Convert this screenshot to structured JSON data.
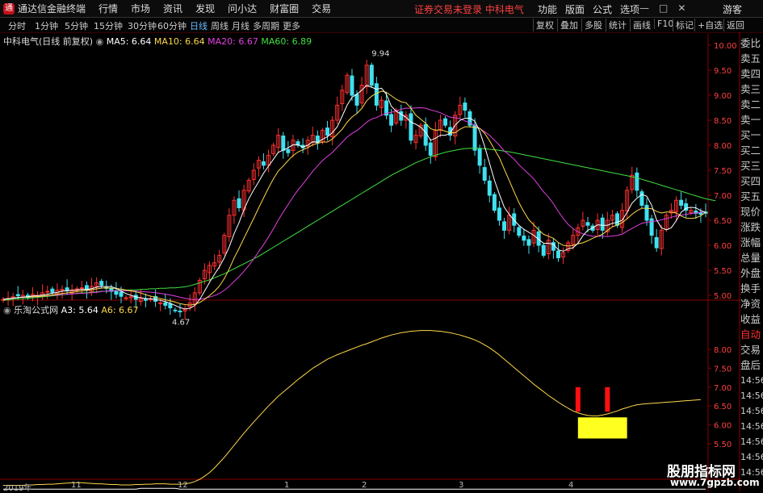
{
  "menu": {
    "app_title": "通达信金融终端",
    "items": [
      "行情",
      "市场",
      "资讯",
      "发现",
      "问小达",
      "财富圈",
      "交易"
    ],
    "alert": "证券交易未登录  中科电气",
    "right_items": [
      "功能",
      "版面",
      "公式",
      "选项"
    ],
    "window_controls": [
      "—",
      "□",
      "✕"
    ],
    "guest": "游客"
  },
  "toolbar": {
    "periods": [
      "分时",
      "1分钟",
      "5分钟",
      "15分钟",
      "30分钟",
      "60分钟",
      "日线",
      "周线",
      "月线",
      "多周期",
      "更多"
    ],
    "active_index": 6,
    "right_buttons": [
      "复权",
      "叠加",
      "多股",
      "统计",
      "画线",
      "F10",
      "标记",
      "+自选",
      "返回"
    ]
  },
  "main_legend": {
    "stock_name": "中科电气(日线 前复权)",
    "ma": [
      {
        "label": "MA5: 6.64",
        "color": "#ffffff"
      },
      {
        "label": "MA10: 6.64",
        "color": "#ffd84a"
      },
      {
        "label": "MA20: 6.67",
        "color": "#e040e0"
      },
      {
        "label": "MA60: 6.89",
        "color": "#40e040"
      }
    ]
  },
  "indicator_legend": {
    "name": "乐淘公式网",
    "lines": [
      {
        "label": "A3: 5.64",
        "color": "#ffffff"
      },
      {
        "label": "A6: 6.67",
        "color": "#ffd84a"
      }
    ]
  },
  "price_axis": [
    "10.00",
    "9.50",
    "9.00",
    "8.50",
    "8.00",
    "7.50",
    "7.00",
    "6.50",
    "6.00",
    "5.50",
    "5.00"
  ],
  "ind_axis": [
    "8.00",
    "7.50",
    "7.00",
    "6.50",
    "6.00",
    "5.50"
  ],
  "annotations": {
    "high": "9.94",
    "low": "4.67"
  },
  "right_panel": {
    "labels": [
      "委比",
      "卖五",
      "卖四",
      "卖三",
      "卖二",
      "卖一",
      "买一",
      "买二",
      "买三",
      "买四",
      "买五",
      "现价",
      "涨跌",
      "涨幅",
      "总量",
      "外盘",
      "换手",
      "净资",
      "收益"
    ],
    "auto": "自动",
    "extra": [
      "交易",
      "盘后"
    ],
    "times": [
      "14:56",
      "14:56",
      "14:56",
      "14:56",
      "14:56",
      "14:56",
      "14:56",
      "14:56",
      "14:56",
      "14:56"
    ]
  },
  "date_axis": [
    "2019年",
    "11",
    "12",
    "1",
    "2",
    "3",
    "4"
  ],
  "watermark": {
    "line1": "股朋指标网",
    "line2": "www.7gpzb.com"
  },
  "colors": {
    "up": "#ff3030",
    "down": "#40e0f0",
    "ma5": "#ffffff",
    "ma10": "#ffd84a",
    "ma20": "#e040e0",
    "ma60": "#40e040",
    "box": "#ffff20"
  },
  "chart_data": {
    "type": "candlestick",
    "close": [
      4.92,
      4.94,
      4.97,
      4.99,
      5.0,
      4.96,
      5.02,
      5.0,
      5.05,
      5.08,
      5.06,
      5.1,
      5.12,
      5.09,
      5.11,
      5.13,
      5.15,
      5.1,
      5.18,
      5.25,
      5.2,
      5.15,
      5.08,
      5.02,
      4.98,
      4.95,
      4.97,
      4.92,
      4.94,
      4.9,
      4.93,
      4.88,
      4.85,
      4.8,
      4.75,
      4.7,
      4.67,
      4.72,
      4.85,
      5.05,
      5.3,
      5.5,
      5.6,
      5.65,
      5.8,
      6.2,
      6.6,
      6.9,
      6.75,
      7.1,
      7.3,
      7.5,
      7.7,
      7.6,
      7.8,
      8.0,
      8.2,
      7.9,
      7.85,
      8.1,
      8.0,
      7.95,
      8.1,
      8.2,
      8.05,
      8.3,
      8.2,
      8.5,
      8.8,
      9.1,
      9.4,
      9.0,
      8.8,
      9.2,
      9.6,
      9.2,
      8.8,
      8.9,
      8.6,
      8.4,
      8.7,
      8.5,
      8.6,
      8.1,
      8.2,
      8.4,
      8.0,
      7.8,
      8.3,
      8.5,
      8.4,
      8.2,
      8.6,
      8.8,
      8.7,
      8.4,
      7.9,
      7.6,
      7.3,
      7.0,
      6.7,
      6.5,
      6.3,
      6.6,
      6.4,
      6.2,
      6.1,
      6.0,
      6.3,
      6.0,
      5.8,
      6.1,
      5.9,
      5.75,
      5.85,
      6.05,
      6.2,
      6.35,
      6.5,
      6.4,
      6.3,
      6.5,
      6.3,
      6.5,
      6.6,
      6.4,
      6.7,
      7.1,
      7.4,
      7.1,
      6.8,
      6.5,
      6.2,
      5.95,
      6.3,
      6.6,
      6.7,
      6.9,
      6.8,
      6.7,
      6.7,
      6.64,
      6.62,
      6.64
    ],
    "ma60": [
      4.9,
      4.91,
      4.92,
      4.93,
      4.93,
      4.94,
      4.95,
      4.96,
      4.97,
      4.98,
      4.99,
      5.0,
      5.01,
      5.02,
      5.03,
      5.04,
      5.05,
      5.05,
      5.06,
      5.07,
      5.08,
      5.08,
      5.09,
      5.09,
      5.1,
      5.1,
      5.11,
      5.11,
      5.12,
      5.12,
      5.13,
      5.13,
      5.14,
      5.14,
      5.15,
      5.15,
      5.16,
      5.17,
      5.19,
      5.22,
      5.25,
      5.28,
      5.31,
      5.35,
      5.39,
      5.43,
      5.48,
      5.53,
      5.58,
      5.63,
      5.68,
      5.73,
      5.78,
      5.84,
      5.9,
      5.96,
      6.02,
      6.08,
      6.14,
      6.2,
      6.26,
      6.32,
      6.38,
      6.44,
      6.5,
      6.56,
      6.62,
      6.68,
      6.74,
      6.8,
      6.86,
      6.92,
      6.98,
      7.04,
      7.1,
      7.16,
      7.22,
      7.28,
      7.34,
      7.4,
      7.45,
      7.5,
      7.55,
      7.6,
      7.65,
      7.69,
      7.73,
      7.77,
      7.8,
      7.83,
      7.86,
      7.88,
      7.9,
      7.92,
      7.93,
      7.94,
      7.94,
      7.94,
      7.93,
      7.92,
      7.91,
      7.9,
      7.88,
      7.87,
      7.85,
      7.83,
      7.81,
      7.79,
      7.77,
      7.75,
      7.73,
      7.71,
      7.69,
      7.67,
      7.65,
      7.63,
      7.61,
      7.59,
      7.57,
      7.55,
      7.53,
      7.51,
      7.49,
      7.47,
      7.45,
      7.43,
      7.41,
      7.39,
      7.37,
      7.35,
      7.32,
      7.29,
      7.26,
      7.23,
      7.2,
      7.17,
      7.14,
      7.11,
      7.08,
      7.05,
      7.02,
      6.99,
      6.96,
      6.93,
      6.91,
      6.89
    ],
    "a6": [
      4.4,
      4.4,
      4.4,
      4.4,
      4.4,
      4.41,
      4.41,
      4.42,
      4.42,
      4.43,
      4.43,
      4.44,
      4.45,
      4.46,
      4.47,
      4.47,
      4.47,
      4.46,
      4.45,
      4.44,
      4.44,
      4.43,
      4.42,
      4.42,
      4.41,
      4.41,
      4.41,
      4.42,
      4.42,
      4.43,
      4.43,
      4.44,
      4.44,
      4.44,
      4.43,
      4.43,
      4.43,
      4.44,
      4.46,
      4.5,
      4.56,
      4.64,
      4.74,
      4.86,
      5.0,
      5.14,
      5.3,
      5.46,
      5.62,
      5.78,
      5.93,
      6.08,
      6.22,
      6.36,
      6.5,
      6.63,
      6.76,
      6.87,
      6.98,
      7.09,
      7.2,
      7.3,
      7.4,
      7.5,
      7.58,
      7.66,
      7.74,
      7.8,
      7.86,
      7.91,
      7.96,
      8.01,
      8.06,
      8.11,
      8.15,
      8.2,
      8.25,
      8.3,
      8.34,
      8.38,
      8.41,
      8.44,
      8.46,
      8.48,
      8.49,
      8.5,
      8.5,
      8.5,
      8.49,
      8.48,
      8.46,
      8.44,
      8.41,
      8.38,
      8.34,
      8.3,
      8.25,
      8.19,
      8.12,
      8.04,
      7.95,
      7.85,
      7.74,
      7.63,
      7.52,
      7.41,
      7.3,
      7.19,
      7.08,
      6.98,
      6.88,
      6.78,
      6.69,
      6.6,
      6.52,
      6.44,
      6.37,
      6.32,
      6.28,
      6.25,
      6.24,
      6.24,
      6.26,
      6.29,
      6.33,
      6.37,
      6.42,
      6.46,
      6.5,
      6.53,
      6.55,
      6.56,
      6.57,
      6.58,
      6.59,
      6.6,
      6.61,
      6.62,
      6.63,
      6.64,
      6.65,
      6.66,
      6.67
    ],
    "a3": [
      4.3,
      4.3,
      4.3,
      4.3,
      4.3,
      4.3,
      4.3,
      4.3,
      4.3,
      4.3,
      4.3,
      4.3,
      4.3,
      4.3,
      4.3,
      4.3,
      4.3,
      4.3,
      4.3,
      4.3,
      4.3,
      4.3,
      4.3,
      4.3,
      4.3,
      4.3,
      4.3,
      4.3,
      4.32,
      4.32,
      4.32,
      4.32,
      4.32,
      4.32,
      4.32,
      4.32,
      4.3,
      4.3,
      4.3,
      4.3,
      4.3,
      4.3,
      4.3,
      4.3,
      4.3,
      4.3,
      4.3,
      4.3,
      4.3,
      4.3,
      4.3,
      4.3,
      4.3,
      4.3,
      4.3,
      4.3,
      4.3,
      4.3,
      4.3,
      4.3,
      4.3,
      4.3,
      4.3,
      4.3,
      4.3,
      4.3,
      4.3,
      4.3,
      4.3,
      4.3,
      4.3,
      4.3,
      4.3,
      4.3,
      4.3,
      4.3,
      4.3,
      4.3,
      4.3,
      4.3,
      4.3,
      4.3,
      4.3,
      4.3,
      4.3,
      4.3,
      4.3,
      4.3,
      4.3,
      4.3,
      4.3,
      4.3,
      4.3,
      4.3,
      4.3,
      4.3,
      4.3,
      4.3,
      4.3,
      4.3,
      4.3,
      4.3,
      4.3,
      4.3,
      4.3,
      4.3,
      4.3,
      4.3,
      4.3,
      4.3,
      4.3,
      4.3,
      4.3,
      4.3,
      4.3,
      4.3,
      4.3,
      4.3,
      4.3,
      4.3,
      4.3,
      4.3,
      4.3,
      4.3,
      4.3,
      4.3,
      4.3,
      4.3,
      4.3,
      4.3,
      4.3,
      4.3,
      4.3,
      4.3,
      4.3,
      4.3,
      4.3,
      4.3,
      4.3,
      4.3,
      4.3,
      4.3,
      4.3,
      4.3
    ],
    "box": {
      "start": 117,
      "end": 127,
      "low": 5.64,
      "high": 6.2
    },
    "up_bars": [
      117,
      123
    ]
  }
}
